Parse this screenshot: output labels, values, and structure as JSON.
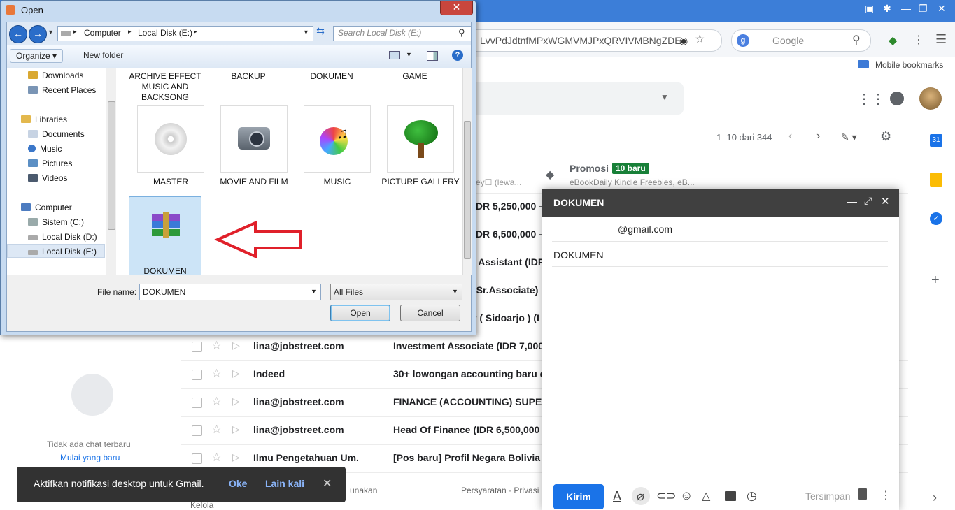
{
  "browser": {
    "url_text": "LvvPdJdtnfMPxWGMVMJPxQRVIVMBNgZDE",
    "search_placeholder": "Google",
    "bookmarks_label": "Mobile bookmarks"
  },
  "gmail": {
    "pagination": "1–10 dari 344",
    "promo": {
      "title": "Promosi",
      "badge": "10 baru",
      "snippet": "eBookDaily Kindle Freebies, eB..."
    },
    "rows": [
      {
        "sender": "",
        "subject": "IDR 5,250,000 - 9"
      },
      {
        "sender": "",
        "subject": "IDR 6,500,000 -"
      },
      {
        "sender": "",
        "subject": "l Assistant (IDR"
      },
      {
        "sender": "",
        "subject": "(Sr.Associate)"
      },
      {
        "sender": "",
        "subject": "r ( Sidoarjo ) (I"
      },
      {
        "sender": "lina@jobstreet.com",
        "subject": "Investment Associate (IDR 7,000"
      },
      {
        "sender": "Indeed",
        "subject": "30+ lowongan accounting baru di"
      },
      {
        "sender": "lina@jobstreet.com",
        "subject": "FINANCE (ACCOUNTING) SUPER"
      },
      {
        "sender": "lina@jobstreet.com",
        "subject": "Head Of Finance (IDR 6,500,000 -"
      },
      {
        "sender": "Ilmu Pengetahuan Um.",
        "subject": "[Pos baru] Profil Negara Bolivia -"
      }
    ],
    "partial_snippet": "ey☐ (lewa...",
    "chat_empty": "Tidak ada chat terbaru",
    "chat_start": "Mulai yang baru",
    "footer_terms": "Persyaratan · Privasi",
    "footer_left": "unakan",
    "manage": "Kelola"
  },
  "compose": {
    "title": "DOKUMEN",
    "to": "@gmail.com",
    "subject": "DOKUMEN",
    "send": "Kirim",
    "saved": "Tersimpan"
  },
  "snackbar": {
    "text": "Aktifkan notifikasi desktop untuk Gmail.",
    "ok": "Oke",
    "later": "Lain kali"
  },
  "dialog": {
    "title": "Open",
    "breadcrumb": [
      "Computer",
      "Local Disk (E:)"
    ],
    "search_placeholder": "Search Local Disk (E:)",
    "organize": "Organize ▾",
    "new_folder": "New folder",
    "nav": [
      {
        "label": "Downloads",
        "icon": "downloads-icon"
      },
      {
        "label": "Recent Places",
        "icon": "recent-places-icon"
      },
      {
        "label": "Libraries",
        "icon": "libraries-icon"
      },
      {
        "label": "Documents",
        "icon": "documents-icon"
      },
      {
        "label": "Music",
        "icon": "music-icon"
      },
      {
        "label": "Pictures",
        "icon": "pictures-icon"
      },
      {
        "label": "Videos",
        "icon": "videos-icon"
      },
      {
        "label": "Computer",
        "icon": "computer-icon"
      },
      {
        "label": "Sistem (C:)",
        "icon": "drive-icon"
      },
      {
        "label": "Local Disk (D:)",
        "icon": "drive-icon"
      },
      {
        "label": "Local Disk (E:)",
        "icon": "drive-icon"
      }
    ],
    "top_items": [
      "ARCHIVE EFFECT MUSIC AND BACKSONG",
      "BACKUP",
      "DOKUMEN",
      "GAME"
    ],
    "items": [
      {
        "label": "MASTER",
        "icon": "cd-icon"
      },
      {
        "label": "MOVIE AND FILM",
        "icon": "camcorder-icon"
      },
      {
        "label": "MUSIC",
        "icon": "music-cd-icon"
      },
      {
        "label": "PICTURE GALLERY",
        "icon": "tree-icon"
      },
      {
        "label": "DOKUMEN",
        "icon": "winrar-archive-icon"
      }
    ],
    "filename_label": "File name:",
    "filename_value": "DOKUMEN",
    "filetype": "All Files",
    "open": "Open",
    "cancel": "Cancel"
  },
  "colors": {
    "annotation_arrow": "#e0202a",
    "gmail_blue": "#1a73e8",
    "badge_green": "#188038"
  }
}
